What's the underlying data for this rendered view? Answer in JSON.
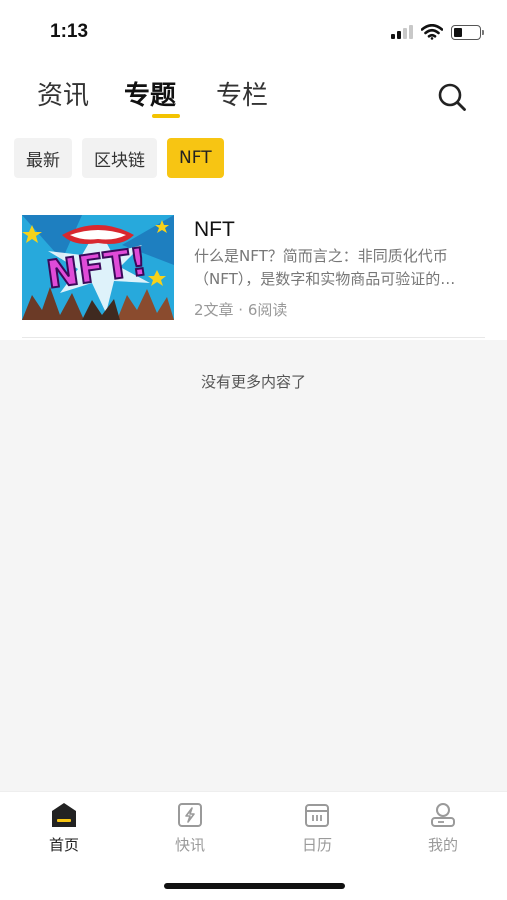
{
  "status_bar": {
    "time": "1:13",
    "battery_level": 0.35
  },
  "header": {
    "tabs": [
      {
        "label": "资讯",
        "active": false
      },
      {
        "label": "专题",
        "active": true
      },
      {
        "label": "专栏",
        "active": false
      }
    ],
    "search_icon": "search-icon"
  },
  "chips": [
    {
      "label": "最新",
      "active": false
    },
    {
      "label": "区块链",
      "active": false
    },
    {
      "label": "NFT",
      "active": true
    }
  ],
  "topics": [
    {
      "title": "NFT",
      "description_line1": "什么是NFT？简而言之：非同质化代币",
      "description_line2": "（NFT），是数字和实物商品可验证的…",
      "meta": "2文章 · 6阅读",
      "thumbnail_text": "NFT!"
    }
  ],
  "no_more_text": "没有更多内容了",
  "bottom_nav": [
    {
      "label": "首页",
      "icon": "home-icon",
      "active": true
    },
    {
      "label": "快讯",
      "icon": "flash-news-icon",
      "active": false
    },
    {
      "label": "日历",
      "icon": "calendar-icon",
      "active": false
    },
    {
      "label": "我的",
      "icon": "profile-icon",
      "active": false
    }
  ],
  "colors": {
    "accent": "#f7c513",
    "background": "#f5f5f5",
    "text_muted": "#999999"
  }
}
